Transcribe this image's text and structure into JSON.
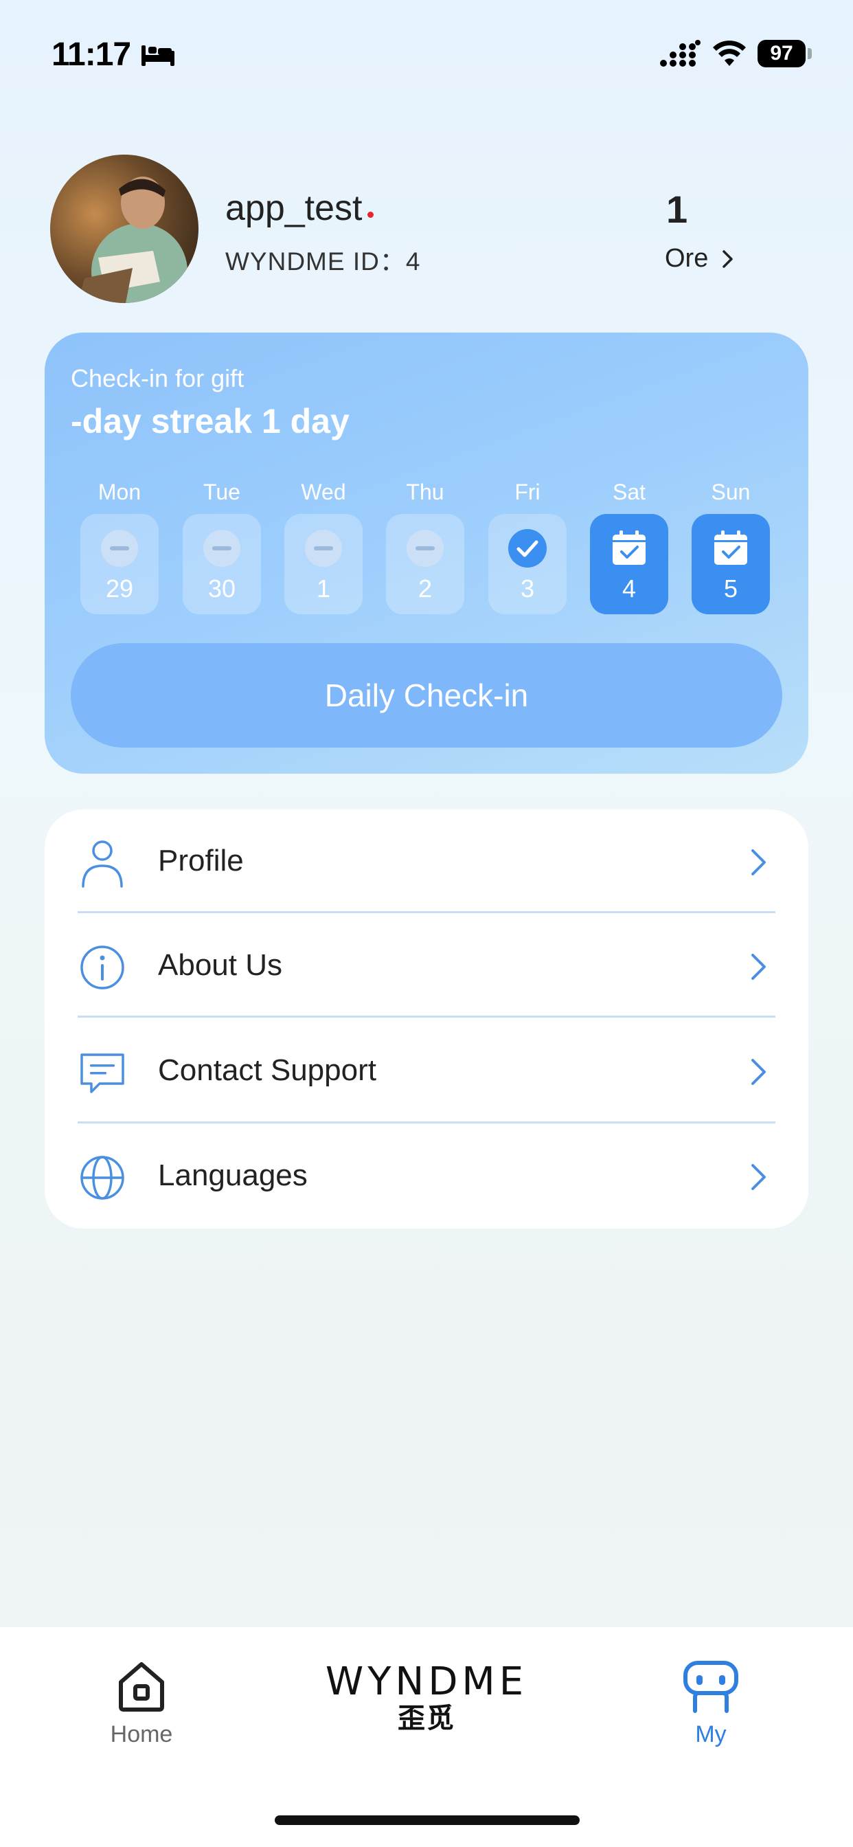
{
  "status_bar": {
    "time": "11:17",
    "battery": "97"
  },
  "profile": {
    "username": "app_test",
    "id_label": "WYNDME ID：",
    "id_value": "4",
    "ore_count": "1",
    "ore_label": "Ore"
  },
  "checkin": {
    "subtitle": "Check-in for gift",
    "title": "-day streak 1 day",
    "days": [
      {
        "name": "Mon",
        "num": "29",
        "state": "missed"
      },
      {
        "name": "Tue",
        "num": "30",
        "state": "missed"
      },
      {
        "name": "Wed",
        "num": "1",
        "state": "missed"
      },
      {
        "name": "Thu",
        "num": "2",
        "state": "missed"
      },
      {
        "name": "Fri",
        "num": "3",
        "state": "checked"
      },
      {
        "name": "Sat",
        "num": "4",
        "state": "upcoming"
      },
      {
        "name": "Sun",
        "num": "5",
        "state": "upcoming"
      }
    ],
    "button_label": "Daily Check-in"
  },
  "menu": {
    "items": [
      {
        "label": "Profile",
        "icon": "person-icon"
      },
      {
        "label": "About Us",
        "icon": "info-icon"
      },
      {
        "label": "Contact Support",
        "icon": "message-icon"
      },
      {
        "label": "Languages",
        "icon": "globe-icon"
      }
    ]
  },
  "bottom_nav": {
    "home_label": "Home",
    "brand_en": "WYNDME",
    "brand_cn": "歪觅",
    "my_label": "My"
  },
  "colors": {
    "accent": "#3b8ff0",
    "card_gradient_start": "#8ec3fb",
    "icon_stroke": "#4a8fe0"
  }
}
